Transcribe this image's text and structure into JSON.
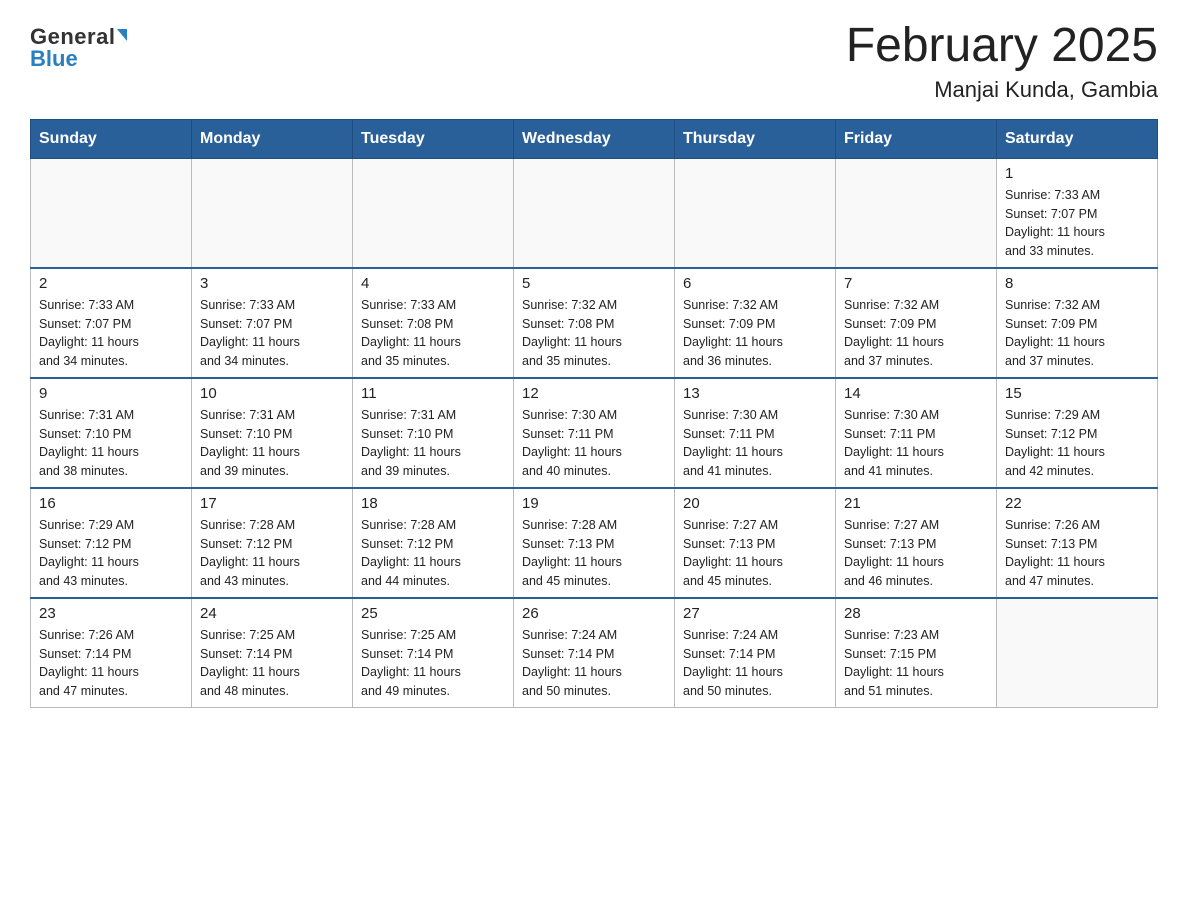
{
  "header": {
    "title": "February 2025",
    "subtitle": "Manjai Kunda, Gambia",
    "logo_general": "General",
    "logo_blue": "Blue"
  },
  "weekdays": [
    "Sunday",
    "Monday",
    "Tuesday",
    "Wednesday",
    "Thursday",
    "Friday",
    "Saturday"
  ],
  "weeks": [
    [
      {
        "day": "",
        "info": ""
      },
      {
        "day": "",
        "info": ""
      },
      {
        "day": "",
        "info": ""
      },
      {
        "day": "",
        "info": ""
      },
      {
        "day": "",
        "info": ""
      },
      {
        "day": "",
        "info": ""
      },
      {
        "day": "1",
        "info": "Sunrise: 7:33 AM\nSunset: 7:07 PM\nDaylight: 11 hours\nand 33 minutes."
      }
    ],
    [
      {
        "day": "2",
        "info": "Sunrise: 7:33 AM\nSunset: 7:07 PM\nDaylight: 11 hours\nand 34 minutes."
      },
      {
        "day": "3",
        "info": "Sunrise: 7:33 AM\nSunset: 7:07 PM\nDaylight: 11 hours\nand 34 minutes."
      },
      {
        "day": "4",
        "info": "Sunrise: 7:33 AM\nSunset: 7:08 PM\nDaylight: 11 hours\nand 35 minutes."
      },
      {
        "day": "5",
        "info": "Sunrise: 7:32 AM\nSunset: 7:08 PM\nDaylight: 11 hours\nand 35 minutes."
      },
      {
        "day": "6",
        "info": "Sunrise: 7:32 AM\nSunset: 7:09 PM\nDaylight: 11 hours\nand 36 minutes."
      },
      {
        "day": "7",
        "info": "Sunrise: 7:32 AM\nSunset: 7:09 PM\nDaylight: 11 hours\nand 37 minutes."
      },
      {
        "day": "8",
        "info": "Sunrise: 7:32 AM\nSunset: 7:09 PM\nDaylight: 11 hours\nand 37 minutes."
      }
    ],
    [
      {
        "day": "9",
        "info": "Sunrise: 7:31 AM\nSunset: 7:10 PM\nDaylight: 11 hours\nand 38 minutes."
      },
      {
        "day": "10",
        "info": "Sunrise: 7:31 AM\nSunset: 7:10 PM\nDaylight: 11 hours\nand 39 minutes."
      },
      {
        "day": "11",
        "info": "Sunrise: 7:31 AM\nSunset: 7:10 PM\nDaylight: 11 hours\nand 39 minutes."
      },
      {
        "day": "12",
        "info": "Sunrise: 7:30 AM\nSunset: 7:11 PM\nDaylight: 11 hours\nand 40 minutes."
      },
      {
        "day": "13",
        "info": "Sunrise: 7:30 AM\nSunset: 7:11 PM\nDaylight: 11 hours\nand 41 minutes."
      },
      {
        "day": "14",
        "info": "Sunrise: 7:30 AM\nSunset: 7:11 PM\nDaylight: 11 hours\nand 41 minutes."
      },
      {
        "day": "15",
        "info": "Sunrise: 7:29 AM\nSunset: 7:12 PM\nDaylight: 11 hours\nand 42 minutes."
      }
    ],
    [
      {
        "day": "16",
        "info": "Sunrise: 7:29 AM\nSunset: 7:12 PM\nDaylight: 11 hours\nand 43 minutes."
      },
      {
        "day": "17",
        "info": "Sunrise: 7:28 AM\nSunset: 7:12 PM\nDaylight: 11 hours\nand 43 minutes."
      },
      {
        "day": "18",
        "info": "Sunrise: 7:28 AM\nSunset: 7:12 PM\nDaylight: 11 hours\nand 44 minutes."
      },
      {
        "day": "19",
        "info": "Sunrise: 7:28 AM\nSunset: 7:13 PM\nDaylight: 11 hours\nand 45 minutes."
      },
      {
        "day": "20",
        "info": "Sunrise: 7:27 AM\nSunset: 7:13 PM\nDaylight: 11 hours\nand 45 minutes."
      },
      {
        "day": "21",
        "info": "Sunrise: 7:27 AM\nSunset: 7:13 PM\nDaylight: 11 hours\nand 46 minutes."
      },
      {
        "day": "22",
        "info": "Sunrise: 7:26 AM\nSunset: 7:13 PM\nDaylight: 11 hours\nand 47 minutes."
      }
    ],
    [
      {
        "day": "23",
        "info": "Sunrise: 7:26 AM\nSunset: 7:14 PM\nDaylight: 11 hours\nand 47 minutes."
      },
      {
        "day": "24",
        "info": "Sunrise: 7:25 AM\nSunset: 7:14 PM\nDaylight: 11 hours\nand 48 minutes."
      },
      {
        "day": "25",
        "info": "Sunrise: 7:25 AM\nSunset: 7:14 PM\nDaylight: 11 hours\nand 49 minutes."
      },
      {
        "day": "26",
        "info": "Sunrise: 7:24 AM\nSunset: 7:14 PM\nDaylight: 11 hours\nand 50 minutes."
      },
      {
        "day": "27",
        "info": "Sunrise: 7:24 AM\nSunset: 7:14 PM\nDaylight: 11 hours\nand 50 minutes."
      },
      {
        "day": "28",
        "info": "Sunrise: 7:23 AM\nSunset: 7:15 PM\nDaylight: 11 hours\nand 51 minutes."
      },
      {
        "day": "",
        "info": ""
      }
    ]
  ]
}
